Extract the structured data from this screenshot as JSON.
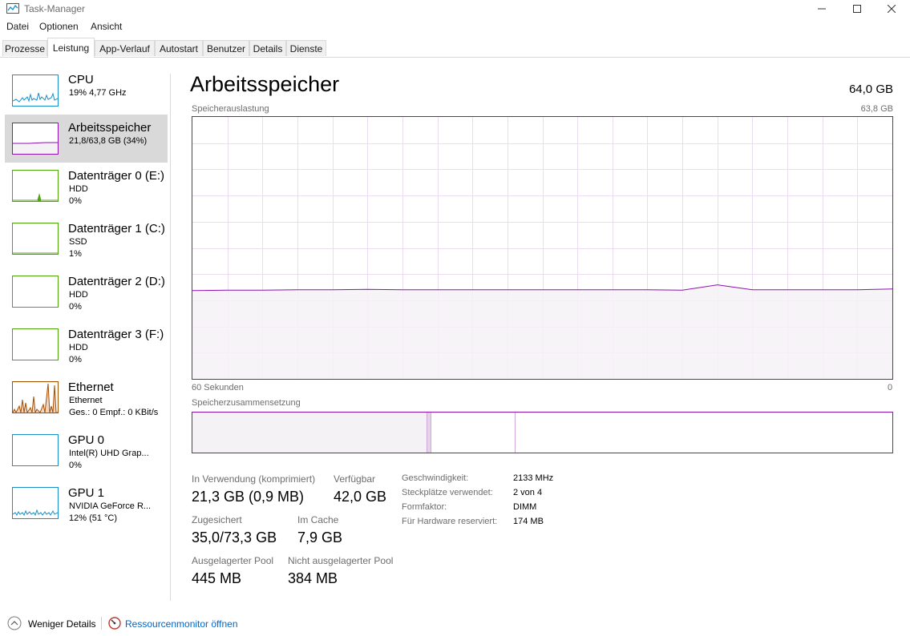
{
  "window": {
    "title": "Task-Manager",
    "controls": [
      "minimize-icon",
      "maximize-icon",
      "close-icon"
    ]
  },
  "menu": {
    "items": [
      "Datei",
      "Optionen",
      "Ansicht"
    ]
  },
  "tabs": [
    {
      "label": "Prozesse",
      "active": false
    },
    {
      "label": "Leistung",
      "active": true
    },
    {
      "label": "App-Verlauf",
      "active": false
    },
    {
      "label": "Autostart",
      "active": false
    },
    {
      "label": "Benutzer",
      "active": false
    },
    {
      "label": "Details",
      "active": false
    },
    {
      "label": "Dienste",
      "active": false
    }
  ],
  "sidebar": {
    "items": [
      {
        "name": "CPU",
        "line1": "19%  4,77 GHz",
        "line2": "",
        "color": "#1a8ec9"
      },
      {
        "name": "Arbeitsspeicher",
        "line1": "21,8/63,8 GB (34%)",
        "line2": "",
        "color": "#8b12ae",
        "selected": true
      },
      {
        "name": "Datenträger 0 (E:)",
        "line1": "HDD",
        "line2": "0%",
        "color": "#4da60c"
      },
      {
        "name": "Datenträger 1 (C:)",
        "line1": "SSD",
        "line2": "1%",
        "color": "#4da60c"
      },
      {
        "name": "Datenträger 2 (D:)",
        "line1": "HDD",
        "line2": "0%",
        "color": "#4da60c"
      },
      {
        "name": "Datenträger 3 (F:)",
        "line1": "HDD",
        "line2": "0%",
        "color": "#4da60c"
      },
      {
        "name": "Ethernet",
        "line1": "Ethernet",
        "line2": "Ges.: 0  Empf.: 0 KBit/s",
        "color": "#a74f01"
      },
      {
        "name": "GPU 0",
        "line1": "Intel(R) UHD Grap...",
        "line2": "0%",
        "color": "#1a8ec9"
      },
      {
        "name": "GPU 1",
        "line1": "NVIDIA GeForce R...",
        "line2": "12%  (51 °C)",
        "color": "#1a8ec9"
      }
    ]
  },
  "main": {
    "title": "Arbeitsspeicher",
    "total": "64,0 GB",
    "usage_label": "Speicherauslastung",
    "usage_max": "63,8 GB",
    "time_label": "60 Sekunden",
    "time_end": "0",
    "composition_label": "Speicherzusammensetzung",
    "accent_color": "#8b12ae",
    "fill_color": "#f4f2f4"
  },
  "chart_data": {
    "type": "area",
    "y_max_gb": 63.8,
    "x": [
      60,
      57,
      54,
      51,
      48,
      45,
      42,
      39,
      36,
      33,
      30,
      27,
      24,
      21,
      18,
      15,
      12,
      9,
      6,
      3,
      0
    ],
    "values": [
      21.5,
      21.6,
      21.6,
      21.7,
      21.7,
      21.8,
      21.7,
      21.7,
      21.7,
      21.7,
      21.7,
      21.7,
      21.7,
      21.7,
      21.6,
      22.9,
      21.7,
      21.7,
      21.7,
      21.7,
      21.9
    ],
    "composition": {
      "in_use_fraction": 0.336,
      "modified_fraction": 0.006,
      "standby_fraction": 0.12,
      "free_fraction": 0.538
    }
  },
  "stats": {
    "in_use_label": "In Verwendung (komprimiert)",
    "in_use_value": "21,3 GB (0,9 MB)",
    "available_label": "Verfügbar",
    "available_value": "42,0 GB",
    "committed_label": "Zugesichert",
    "committed_value": "35,0/73,3 GB",
    "cached_label": "Im Cache",
    "cached_value": "7,9 GB",
    "paged_label": "Ausgelagerter Pool",
    "paged_value": "445 MB",
    "nonpaged_label": "Nicht ausgelagerter Pool",
    "nonpaged_value": "384 MB"
  },
  "info": [
    {
      "label": "Geschwindigkeit:",
      "value": "2133 MHz"
    },
    {
      "label": "Steckplätze verwendet:",
      "value": "2 von 4"
    },
    {
      "label": "Formfaktor:",
      "value": "DIMM"
    },
    {
      "label": "Für Hardware reserviert:",
      "value": "174 MB"
    }
  ],
  "footer": {
    "less_details": "Weniger Details",
    "resource_monitor": "Ressourcenmonitor öffnen"
  }
}
